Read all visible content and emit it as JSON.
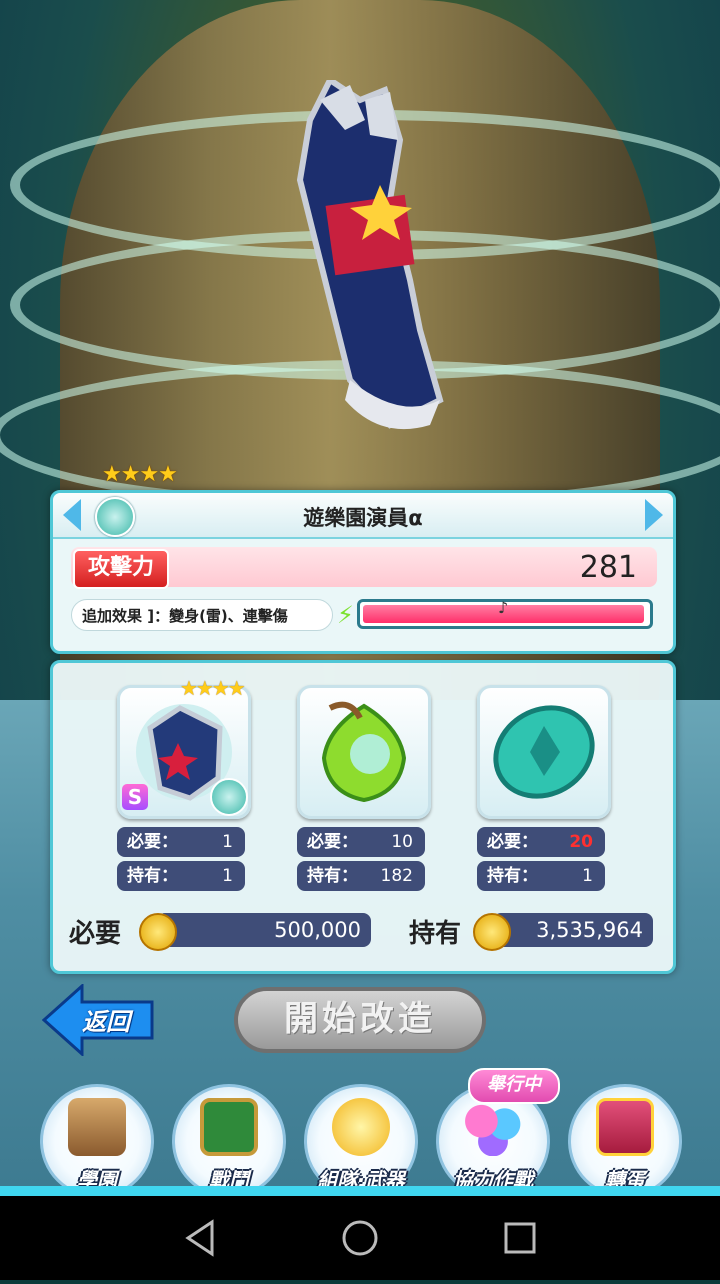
{
  "weapon": {
    "name": "遊樂園演員α",
    "stars": "★★★★",
    "attack_label": "攻擊力",
    "attack_value": "281",
    "effect_text": "追加效果 ]：變身(雷)、連擊傷",
    "gauge_level": 0.99
  },
  "materials": [
    {
      "stars": "★★★★",
      "badge": "S",
      "required_label": "必要：",
      "required": "1",
      "owned_label": "持有：",
      "owned": "1",
      "icon": "gauntlet-icon"
    },
    {
      "required_label": "必要：",
      "required": "10",
      "owned_label": "持有：",
      "owned": "182",
      "icon": "green-gem-icon"
    },
    {
      "required_label": "必要：",
      "required": "20",
      "owned_label": "持有：",
      "owned": "1",
      "icon": "teal-stone-icon",
      "insufficient": true
    }
  ],
  "cost": {
    "required_label": "必要",
    "required_value": "500,000",
    "owned_label": "持有",
    "owned_value": "3,535,964"
  },
  "buttons": {
    "back": "返回",
    "start": "開始改造"
  },
  "nav": [
    {
      "label": "學園",
      "icon": "school-icon"
    },
    {
      "label": "戰鬥",
      "icon": "battle-board-icon"
    },
    {
      "label": "組隊·武器",
      "icon": "star-compass-icon"
    },
    {
      "label": "協力作戰",
      "icon": "coop-balloons-icon"
    },
    {
      "label": "轉蛋",
      "icon": "gacha-card-icon"
    }
  ],
  "event_badge": "舉行中",
  "colors": {
    "accent": "#4fc7d6",
    "attack": "#d42020",
    "pill": "#3f4d78",
    "insufficient": "#ff3030"
  }
}
